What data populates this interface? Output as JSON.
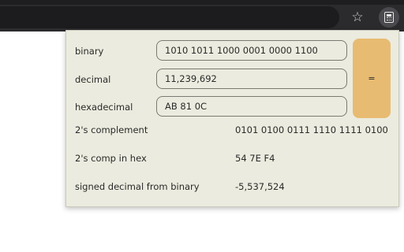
{
  "browser": {
    "star_icon": "star-icon",
    "extension_icon": "calculator-icon"
  },
  "popup": {
    "inputs": {
      "binary": {
        "label": "binary",
        "value": "1010 1011 1000 0001 0000 1100"
      },
      "decimal": {
        "label": "decimal",
        "value": "11,239,692"
      },
      "hexadecimal": {
        "label": "hexadecimal",
        "value": "AB 81 0C"
      }
    },
    "equals_label": "=",
    "results": {
      "twos_complement": {
        "label": "2's complement",
        "value": "0101 0100 0111 1110 1111 0100"
      },
      "twos_comp_hex": {
        "label": "2's comp in hex",
        "value": "54 7E F4"
      },
      "signed_decimal": {
        "label": "signed decimal from binary",
        "value": "-5,537,524"
      }
    },
    "colors": {
      "background": "#ebebdf",
      "equals_button": "#e8bb72"
    }
  }
}
